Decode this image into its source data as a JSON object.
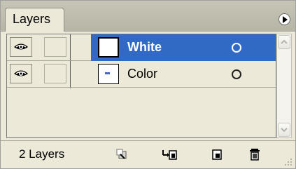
{
  "panel": {
    "tab_label": "Layers",
    "menu_icon": "panel-menu-icon"
  },
  "layers": [
    {
      "name": "White",
      "visible": true,
      "selected": true
    },
    {
      "name": "Color",
      "visible": true,
      "selected": false
    }
  ],
  "footer": {
    "count_label": "2 Layers",
    "buttons": [
      "delete-layer-state-icon",
      "update-layer-comp-icon",
      "new-layer-icon",
      "trash-icon"
    ]
  },
  "colors": {
    "selection": "#316ac5",
    "panel_bg": "#ece9d8"
  }
}
